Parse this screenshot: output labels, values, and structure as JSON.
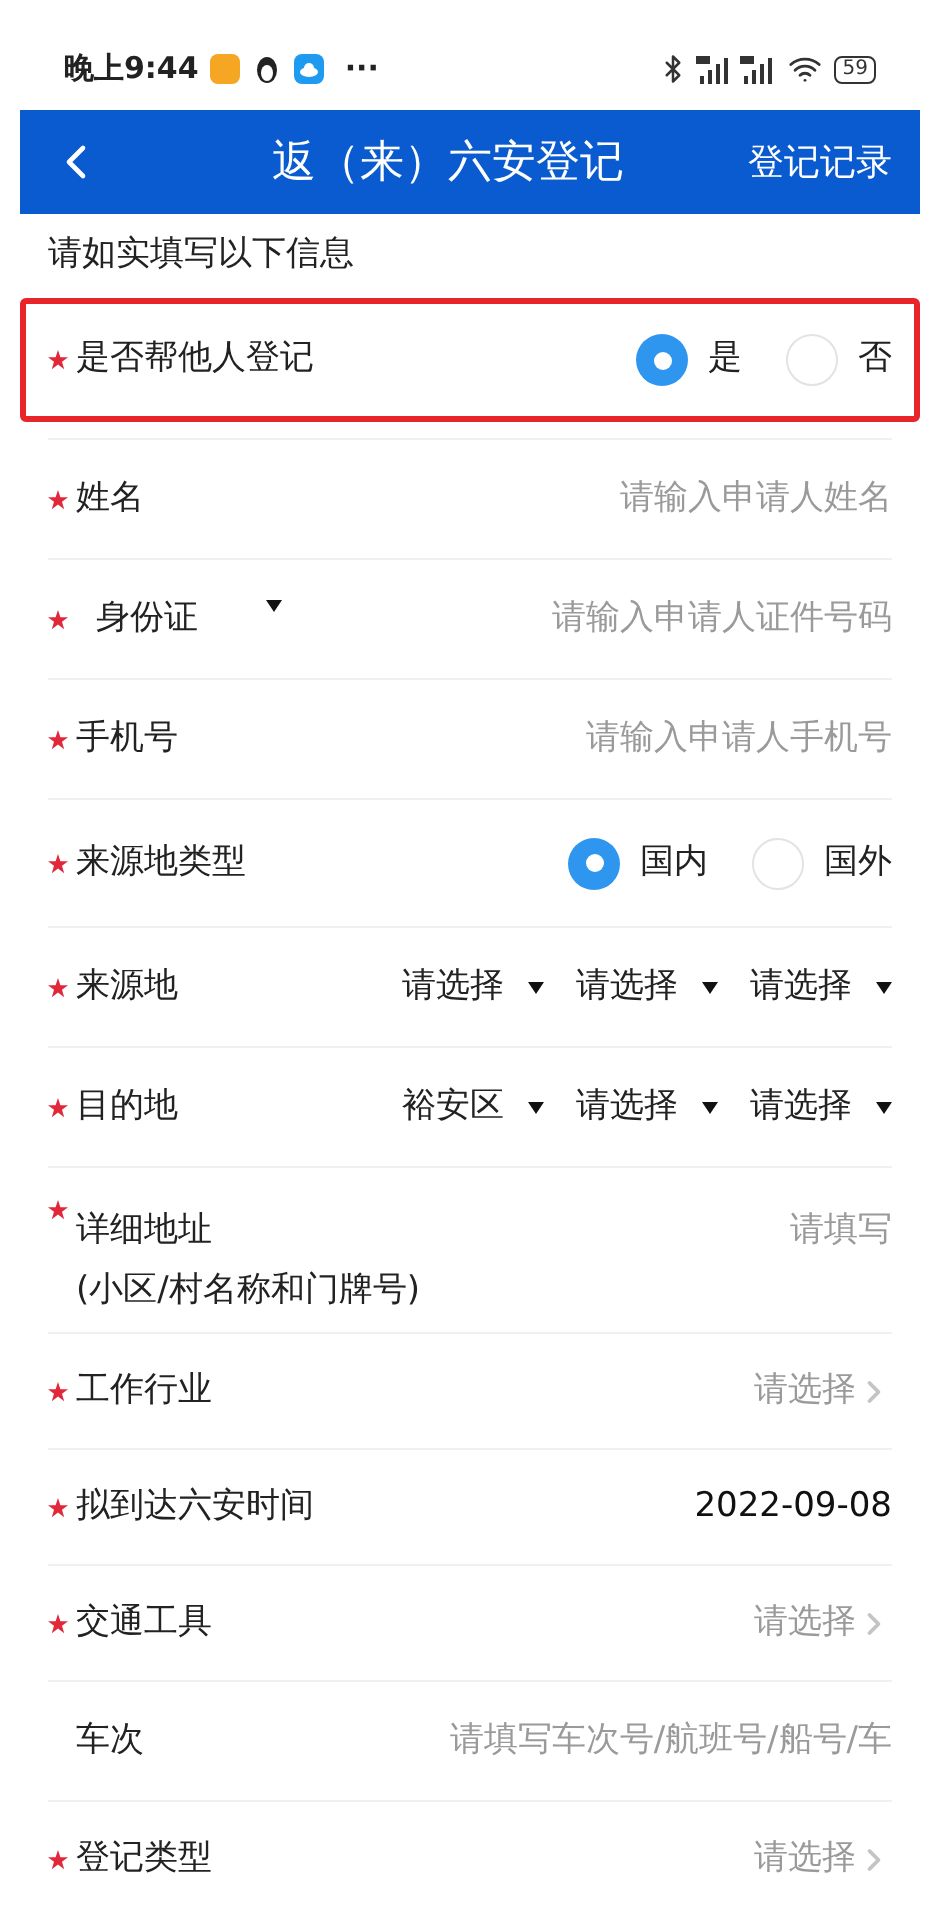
{
  "status_bar": {
    "time": "晚上9:44",
    "more": "···",
    "battery": "59"
  },
  "header": {
    "title": "返（来）六安登记",
    "action": "登记记录"
  },
  "intro": "请如实填写以下信息",
  "fields": [
    {
      "kind": "radio",
      "label": "是否帮他人登记",
      "required": true,
      "highlighted": true,
      "options": [
        {
          "label": "是",
          "selected": true
        },
        {
          "label": "否",
          "selected": false
        }
      ]
    },
    {
      "kind": "input",
      "label": "姓名",
      "required": true,
      "highlighted": false,
      "placeholder": "请输入申请人姓名"
    },
    {
      "kind": "id_input",
      "label": "身份证",
      "required": true,
      "highlighted": false,
      "placeholder": "请输入申请人证件号码"
    },
    {
      "kind": "input",
      "label": "手机号",
      "required": true,
      "highlighted": false,
      "placeholder": "请输入申请人手机号"
    },
    {
      "kind": "radio",
      "label": "来源地类型",
      "required": true,
      "highlighted": false,
      "options": [
        {
          "label": "国内",
          "selected": true
        },
        {
          "label": "国外",
          "selected": false
        }
      ]
    },
    {
      "kind": "region",
      "label": "来源地",
      "required": true,
      "highlighted": false,
      "selects": [
        "请选择",
        "请选择",
        "请选择"
      ]
    },
    {
      "kind": "region",
      "label": "目的地",
      "required": true,
      "highlighted": false,
      "selects": [
        "裕安区",
        "请选择",
        "请选择"
      ]
    },
    {
      "kind": "address",
      "label": "详细地址",
      "sublabel": "(小区/村名称和门牌号)",
      "required": true,
      "highlighted": false,
      "placeholder": "请填写"
    },
    {
      "kind": "picker",
      "label": "工作行业",
      "required": true,
      "highlighted": false,
      "placeholder": "请选择"
    },
    {
      "kind": "value",
      "label": "拟到达六安时间",
      "required": true,
      "highlighted": false,
      "value": "2022-09-08"
    },
    {
      "kind": "picker",
      "label": "交通工具",
      "required": true,
      "highlighted": false,
      "placeholder": "请选择"
    },
    {
      "kind": "input",
      "label": "车次",
      "required": false,
      "highlighted": false,
      "placeholder": "请填写车次号/航班号/船号/车"
    },
    {
      "kind": "picker",
      "label": "登记类型",
      "required": true,
      "highlighted": false,
      "placeholder": "请选择"
    }
  ]
}
